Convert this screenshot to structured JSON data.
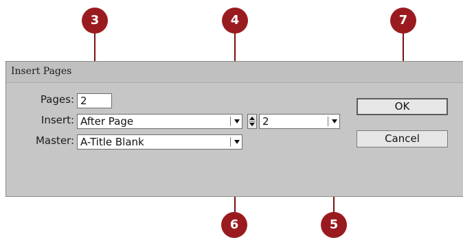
{
  "dialog": {
    "title": "Insert Pages",
    "pages_label": "Pages:",
    "pages_value": "2",
    "insert_label": "Insert:",
    "insert_value": "After Page",
    "page_number_value": "2",
    "master_label": "Master:",
    "master_value": "A-Title Blank",
    "ok_label": "OK",
    "cancel_label": "Cancel"
  },
  "callouts": [
    "3",
    "4",
    "7",
    "6",
    "5"
  ]
}
